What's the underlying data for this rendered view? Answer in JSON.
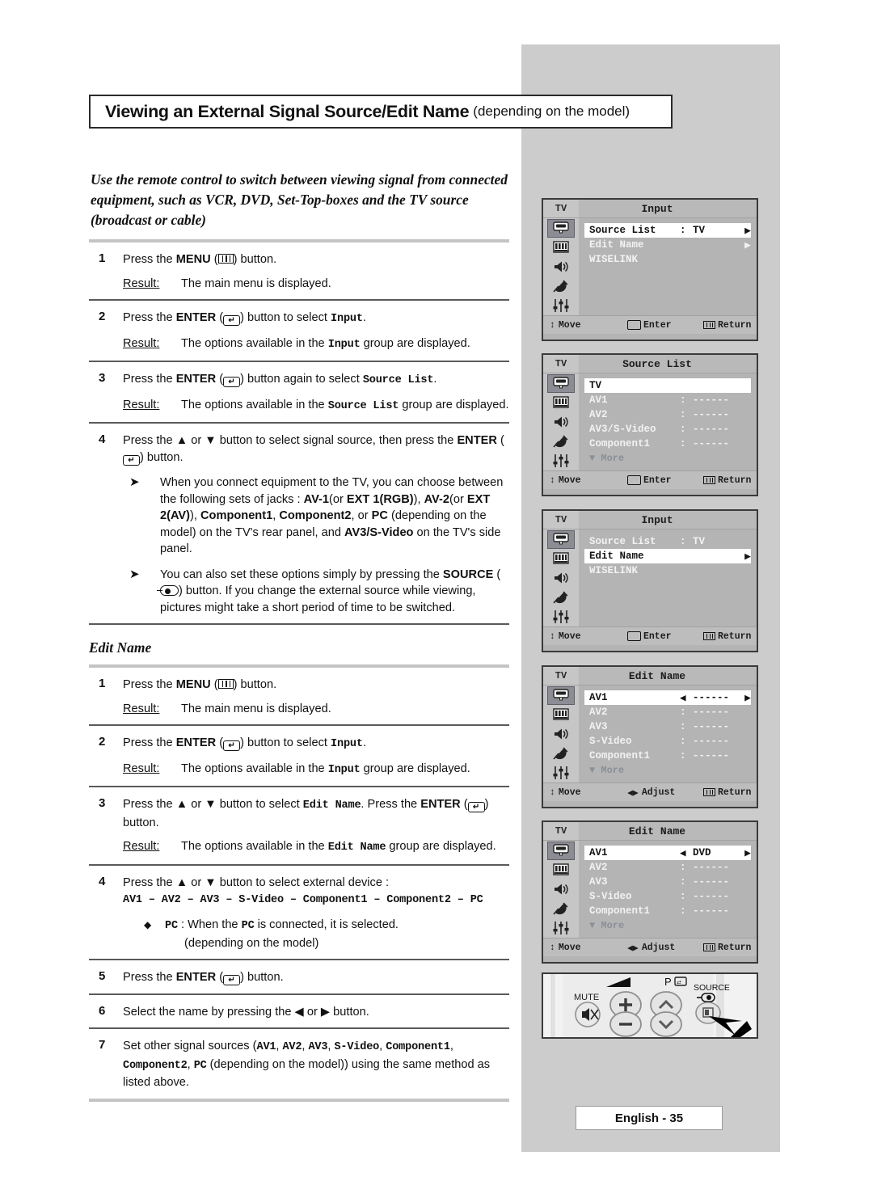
{
  "header": {
    "title_main": "Viewing an External Signal Source/Edit Name",
    "title_sub": "(depending on the model)"
  },
  "intro": "Use the remote control to switch between viewing signal from connected equipment, such as VCR, DVD, Set-Top-boxes and the TV source (broadcast or cable)",
  "section1": {
    "steps": [
      {
        "num": "1",
        "text_a": "Press the ",
        "bold_a": "MENU",
        "text_b": " (",
        "text_c": ") button.",
        "result_label": "Result:",
        "result_text": "The main menu is displayed."
      },
      {
        "num": "2",
        "text_a": "Press the ",
        "bold_a": "ENTER",
        "text_b": " (",
        "text_c": ") button to select ",
        "mono_a": "Input",
        "text_d": ".",
        "result_label": "Result:",
        "result_pre": "The options available in the ",
        "result_mono": "Input",
        "result_post": " group are displayed."
      },
      {
        "num": "3",
        "text_a": "Press the ",
        "bold_a": "ENTER",
        "text_b": " (",
        "text_c": ") button again to select ",
        "mono_a": "Source List",
        "text_d": ".",
        "result_label": "Result:",
        "result_pre": "The options available in the ",
        "result_mono": "Source List",
        "result_post": " group are displayed."
      },
      {
        "num": "4",
        "line1_a": "Press the ",
        "line1_b": " or ",
        "line1_c": " button to select signal source, then press the ",
        "line1_bold": "ENTER",
        "line1_d": " (",
        "line1_e": ") button."
      }
    ],
    "notes": [
      {
        "p1": "When you connect equipment to the TV, you can choose between the following sets of jacks : ",
        "b1": "AV-1",
        "p2": "(or ",
        "b2": "EXT 1(RGB)",
        "p3": "), ",
        "b3": "AV-2",
        "p4": "(or ",
        "b4": "EXT 2(AV)",
        "p5": "), ",
        "b5": "Component1",
        "p6": ", ",
        "b6": "Component2",
        "p7": ", or ",
        "b7": "PC",
        "p8": " (depending on the model) on the TV's rear panel, and ",
        "b8": "AV3/S-Video",
        "p9": " on the TV's side panel."
      },
      {
        "p1": "You can also set these options simply by pressing the ",
        "b1": "SOURCE",
        "p2": " (",
        "p3": ") button. If you change the external source while viewing, pictures might take a short period of time to be switched."
      }
    ]
  },
  "section2": {
    "heading": "Edit Name",
    "steps": [
      {
        "num": "1",
        "text_a": "Press the ",
        "bold_a": "MENU",
        "text_b": " (",
        "text_c": ") button.",
        "result_label": "Result:",
        "result_text": "The main menu is displayed."
      },
      {
        "num": "2",
        "text_a": "Press the ",
        "bold_a": "ENTER",
        "text_b": " (",
        "text_c": ") button to select ",
        "mono_a": "Input",
        "text_d": ".",
        "result_label": "Result:",
        "result_pre": "The options available in the ",
        "result_mono": "Input",
        "result_post": " group are displayed."
      },
      {
        "num": "3",
        "line_a": "Press the ",
        "line_b": " or ",
        "line_c": " button to select ",
        "mono_a": "Edit Name",
        "line_d": ". Press the ",
        "bold_a": "ENTER",
        "line_e": " (",
        "line_f": ") button.",
        "result_label": "Result:",
        "result_pre": "The options available in the ",
        "result_mono": "Edit Name",
        "result_post": " group are displayed."
      },
      {
        "num": "4",
        "line1_a": "Press the ",
        "line1_b": " or ",
        "line1_c": " button to select external device :",
        "device_chain": "AV1 – AV2 – AV3 – S-Video – Component1 – Component2 – PC",
        "diamond": "◆",
        "note_mono1": "PC",
        "note_t1": " : When the ",
        "note_mono2": "PC",
        "note_t2": " is connected, it is selected.",
        "note_t3": "(depending on the model)"
      },
      {
        "num": "5",
        "text_a": "Press the ",
        "bold_a": "ENTER",
        "text_b": " (",
        "text_c": ") button."
      },
      {
        "num": "6",
        "text_a": "Select the name by pressing the ",
        "text_b": " or ",
        "text_c": " button."
      },
      {
        "num": "7",
        "t_a": "Set other signal sources (",
        "m1": "AV1",
        "t_b": ", ",
        "m2": "AV2",
        "t_c": ", ",
        "m3": "AV3",
        "t_d": ", ",
        "m4": "S-Video",
        "t_e": ", ",
        "m5": "Component1",
        "t_f": ", ",
        "m6": "Component2",
        "t_g": ", ",
        "m7": "PC",
        "t_h": " (depending on the model)) using the same method as listed above."
      }
    ]
  },
  "osd_panels": [
    {
      "tv_tag": "TV",
      "title": "Input",
      "rows": [
        {
          "label": "Source List",
          "colon": ":",
          "value": "TV",
          "arrow": "▶",
          "highlight": true
        },
        {
          "label": "Edit Name",
          "colon": "",
          "value": "",
          "arrow": "▶",
          "highlight": false
        },
        {
          "label": "WISELINK",
          "colon": "",
          "value": "",
          "arrow": "",
          "highlight": false
        }
      ],
      "more": "",
      "footer": {
        "move": "Move",
        "mid": "Enter",
        "return": "Return",
        "move_glyph": "updown",
        "mid_glyph": "enter"
      }
    },
    {
      "tv_tag": "TV",
      "title": "Source List",
      "rows": [
        {
          "label": "TV",
          "colon": "",
          "value": "",
          "arrow": "",
          "highlight": true
        },
        {
          "label": "AV1",
          "colon": ":",
          "value": "------",
          "arrow": "",
          "highlight": false
        },
        {
          "label": "AV2",
          "colon": ":",
          "value": "------",
          "arrow": "",
          "highlight": false
        },
        {
          "label": "AV3/S-Video",
          "colon": ":",
          "value": "------",
          "arrow": "",
          "highlight": false
        },
        {
          "label": "Component1",
          "colon": ":",
          "value": "------",
          "arrow": "",
          "highlight": false
        }
      ],
      "more": "▼ More",
      "footer": {
        "move": "Move",
        "mid": "Enter",
        "return": "Return",
        "move_glyph": "updown",
        "mid_glyph": "enter"
      }
    },
    {
      "tv_tag": "TV",
      "title": "Input",
      "rows": [
        {
          "label": "Source List",
          "colon": ":",
          "value": "TV",
          "arrow": "",
          "highlight": false
        },
        {
          "label": "Edit Name",
          "colon": "",
          "value": "",
          "arrow": "▶",
          "highlight": true
        },
        {
          "label": "WISELINK",
          "colon": "",
          "value": "",
          "arrow": "",
          "highlight": false
        }
      ],
      "more": "",
      "footer": {
        "move": "Move",
        "mid": "Enter",
        "return": "Return",
        "move_glyph": "updown",
        "mid_glyph": "enter"
      }
    },
    {
      "tv_tag": "TV",
      "title": "Edit Name",
      "rows": [
        {
          "label": "AV1",
          "colon": "◀",
          "value": "------",
          "arrow": "▶",
          "highlight": true
        },
        {
          "label": "AV2",
          "colon": ":",
          "value": "------",
          "arrow": "",
          "highlight": false
        },
        {
          "label": "AV3",
          "colon": ":",
          "value": "------",
          "arrow": "",
          "highlight": false
        },
        {
          "label": "S-Video",
          "colon": ":",
          "value": "------",
          "arrow": "",
          "highlight": false
        },
        {
          "label": "Component1",
          "colon": ":",
          "value": "------",
          "arrow": "",
          "highlight": false
        }
      ],
      "more": "▼ More",
      "footer": {
        "move": "Move",
        "mid": "Adjust",
        "return": "Return",
        "move_glyph": "updown",
        "mid_glyph": "leftright"
      }
    },
    {
      "tv_tag": "TV",
      "title": "Edit Name",
      "rows": [
        {
          "label": "AV1",
          "colon": "◀",
          "value": "DVD",
          "arrow": "▶",
          "highlight": true
        },
        {
          "label": "AV2",
          "colon": ":",
          "value": "------",
          "arrow": "",
          "highlight": false
        },
        {
          "label": "AV3",
          "colon": ":",
          "value": "------",
          "arrow": "",
          "highlight": false
        },
        {
          "label": "S-Video",
          "colon": ":",
          "value": "------",
          "arrow": "",
          "highlight": false
        },
        {
          "label": "Component1",
          "colon": ":",
          "value": "------",
          "arrow": "",
          "highlight": false
        }
      ],
      "more": "▼ More",
      "footer": {
        "move": "Move",
        "mid": "Adjust",
        "return": "Return",
        "move_glyph": "updown",
        "mid_glyph": "leftright"
      }
    }
  ],
  "sidebar_icons": [
    "input-icon",
    "picture-icon",
    "sound-icon",
    "channel-icon",
    "setup-icon"
  ],
  "remote": {
    "mute_label": "MUTE",
    "p_label": "P",
    "source_label": "SOURCE",
    "vol_up": "+",
    "vol_down": "−",
    "ch_up": "∧",
    "ch_down": "∨"
  },
  "footer": {
    "page": "English - 35"
  },
  "colors": {
    "panel_bg": "#cccccc",
    "osd_bg": "#b4b4b4",
    "osd_side": "#c6c6c6",
    "sel": "#8c8c95"
  }
}
